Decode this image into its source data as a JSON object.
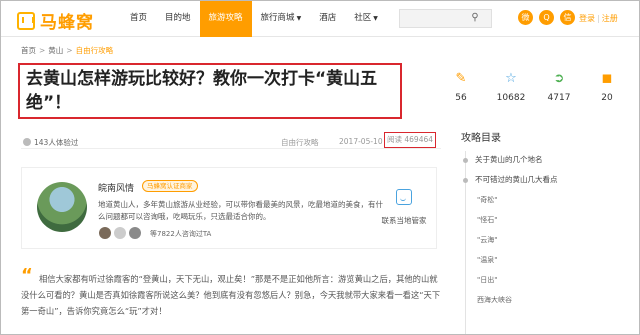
{
  "header": {
    "logo_text": "马蜂窝",
    "nav": [
      {
        "label": "首页",
        "active": false,
        "dropdown": false
      },
      {
        "label": "目的地",
        "active": false,
        "dropdown": false
      },
      {
        "label": "旅游攻略",
        "active": true,
        "dropdown": false
      },
      {
        "label": "旅行商城",
        "active": false,
        "dropdown": true
      },
      {
        "label": "酒店",
        "active": false,
        "dropdown": false
      },
      {
        "label": "社区",
        "active": false,
        "dropdown": true
      }
    ],
    "login": "登录",
    "register": "注册",
    "accent_color": "#ff9d00"
  },
  "breadcrumb": [
    "首页",
    "黄山",
    "自由行攻略"
  ],
  "article": {
    "title": "去黄山怎样游玩比较好？教你一次打卡“黄山五绝”！",
    "experienced": "143人体验过",
    "category": "自由行攻略",
    "date": "2017-05-10",
    "views": "阅读 469464"
  },
  "stats": {
    "comments": "56",
    "favorites": "10682",
    "shares": "4717",
    "gold": "20"
  },
  "author": {
    "name": "皖南风情",
    "badge": "马蜂窝认证商家",
    "desc": "地道黄山人，多年黄山旅游从业经验，可以带你看最美的风景，吃最地道的美食，有什么问题都可以咨询哦，吃喝玩乐，只选最适合你的。",
    "consult": "等7822人咨询过TA",
    "contact_label": "联系当地管家"
  },
  "body": "相信大家都有听过徐霞客的“登黄山，天下无山，观止矣！”那是不是正如他所言：游览黄山之后，其他的山就没什么可看的？黄山是否真如徐霞客所说这么美？他到底有没有忽悠后人？别急，今天我就带大家来看一看这“天下第一奇山”，告诉你究竟怎么“玩”才对！",
  "toc": {
    "title": "攻略目录",
    "items": [
      {
        "label": "关于黄山的几个地名",
        "level": 1
      },
      {
        "label": "不可错过的黄山几大看点",
        "level": 1
      },
      {
        "label": "\"奇松\"",
        "level": 2
      },
      {
        "label": "\"怪石\"",
        "level": 2
      },
      {
        "label": "\"云海\"",
        "level": 2
      },
      {
        "label": "\"温泉\"",
        "level": 2
      },
      {
        "label": "\"日出\"",
        "level": 2
      },
      {
        "label": "西海大峡谷",
        "level": 2
      }
    ]
  },
  "icons": {
    "comments": "edit-icon",
    "favorites": "star-icon",
    "shares": "share-icon",
    "gold": "gold-coin-icon",
    "contact": "chat-icon"
  }
}
